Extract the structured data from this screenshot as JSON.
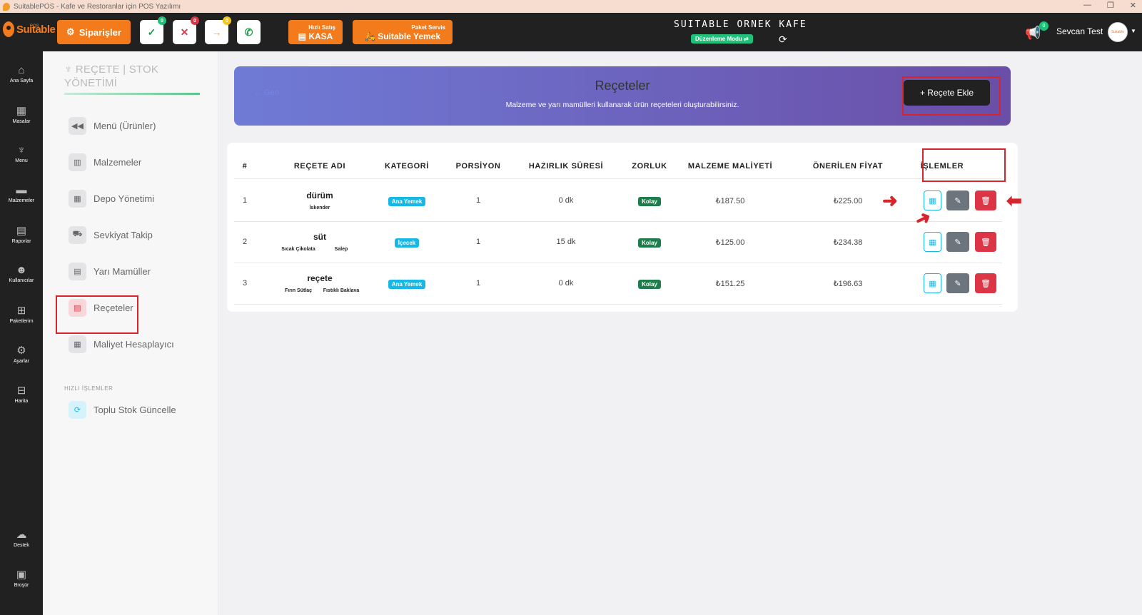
{
  "window": {
    "title": "SuitablePOS - Kafe ve Restoranlar için POS Yazılımı"
  },
  "topbar": {
    "logo_text": "Suitable",
    "logo_sub": "POS",
    "siparisler_label": "Siparişler",
    "status_buttons": [
      {
        "glyph": "✓",
        "count": "0",
        "color": "#1e9e4a",
        "badge": "#20c07a"
      },
      {
        "glyph": "✕",
        "count": "0",
        "color": "#dc3545",
        "badge": "#dc3545"
      },
      {
        "glyph": "→",
        "count": "0",
        "color": "#f5a623",
        "badge": "#f5c518"
      },
      {
        "glyph": "✆",
        "count": "",
        "color": "#1e9e4a",
        "badge": ""
      }
    ],
    "kasa_caption": "Hızlı Satış",
    "kasa_label": "KASA",
    "yemek_caption": "Paket Servis",
    "yemek_label": "Suitable Yemek",
    "cafe_name": "SUITABLE ORNEK KAFE",
    "edit_mode": "Düzenleme Modu ⇄",
    "notif_count": "0",
    "user_name": "Sevcan Test",
    "avatar_text": "Suitable"
  },
  "rail": [
    {
      "icon": "⌂",
      "label": "Ana Sayfa"
    },
    {
      "icon": "▦",
      "label": "Masalar"
    },
    {
      "icon": "♆",
      "label": "Menu"
    },
    {
      "icon": "▬",
      "label": "Malzemeler"
    },
    {
      "icon": "▤",
      "label": "Raporlar"
    },
    {
      "icon": "☻",
      "label": "Kullanıcılar"
    },
    {
      "icon": "⊞",
      "label": "Paketlerim"
    },
    {
      "icon": "⚙",
      "label": "Ayarlar"
    },
    {
      "icon": "⊟",
      "label": "Harita"
    },
    {
      "icon": "☁",
      "label": "Destek"
    },
    {
      "icon": "▣",
      "label": "Broşür"
    }
  ],
  "sidebar": {
    "title": "REÇETE | STOK YÖNETİMİ",
    "items": [
      {
        "label": "Menü (Ürünler)",
        "icon": "◀◀"
      },
      {
        "label": "Malzemeler",
        "icon": "▥"
      },
      {
        "label": "Depo Yönetimi",
        "icon": "▦"
      },
      {
        "label": "Sevkiyat Takip",
        "icon": "⛟"
      },
      {
        "label": "Yarı Mamüller",
        "icon": "▤"
      },
      {
        "label": "Reçeteler",
        "icon": "▤"
      },
      {
        "label": "Maliyet Hesaplayıcı",
        "icon": "▦"
      }
    ],
    "section_label": "HIZLI İŞLEMLER",
    "quick_items": [
      {
        "label": "Toplu Stok Güncelle",
        "icon": "⟳"
      }
    ]
  },
  "hero": {
    "back_label": "← Geri",
    "title": "Reçeteler",
    "subtitle": "Malzeme ve yarı mamülleri kullanarak ürün reçeteleri oluşturabilirsiniz.",
    "add_label": "+ Reçete Ekle"
  },
  "table": {
    "columns": [
      "#",
      "REÇETE ADI",
      "KATEGORİ",
      "PORSİYON",
      "HAZIRLIK SÜRESİ",
      "ZORLUK",
      "MALZEME MALİYETİ",
      "ÖNERİLEN FİYAT",
      "İŞLEMLER"
    ],
    "rows": [
      {
        "no": "1",
        "name": "dürüm",
        "tags": [
          "İskender"
        ],
        "category": "Ana Yemek",
        "portion": "1",
        "prep": "0 dk",
        "difficulty": "Kolay",
        "cost": "₺187.50",
        "price": "₺225.00"
      },
      {
        "no": "2",
        "name": "süt",
        "tags": [
          "Sıcak Çikolata",
          "Salep"
        ],
        "category": "İçecek",
        "portion": "1",
        "prep": "15 dk",
        "difficulty": "Kolay",
        "cost": "₺125.00",
        "price": "₺234.38"
      },
      {
        "no": "3",
        "name": "reçete",
        "tags": [
          "Fırın Sütlaç",
          "Fıstıklı Baklava"
        ],
        "category": "Ana Yemek",
        "portion": "1",
        "prep": "0 dk",
        "difficulty": "Kolay",
        "cost": "₺151.25",
        "price": "₺196.63"
      }
    ],
    "actions": {
      "calc_icon": "▦",
      "edit_icon": "✎",
      "delete_icon": "🗑"
    }
  },
  "annotations": {
    "arrow_right": "➜",
    "arrow_left": "⬅"
  }
}
